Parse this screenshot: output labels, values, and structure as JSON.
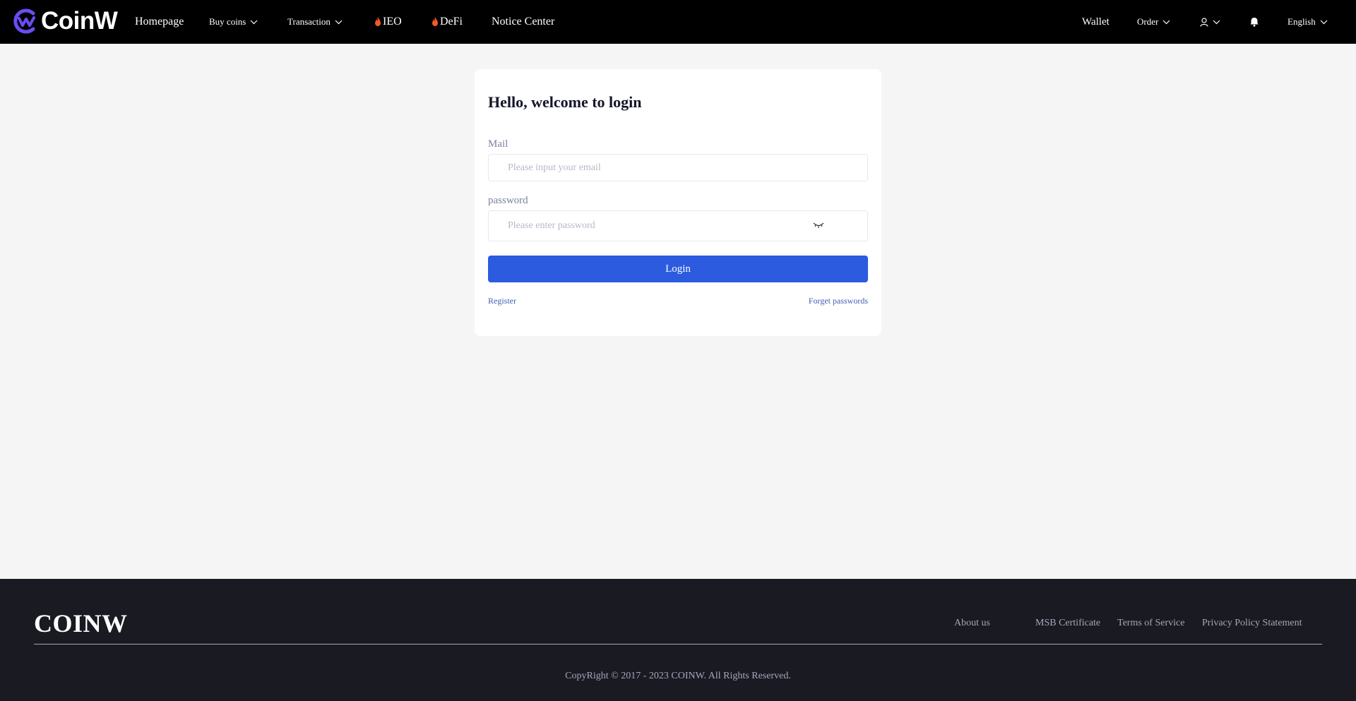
{
  "header": {
    "brand": "CoinW",
    "nav": {
      "homepage": "Homepage",
      "buy_coins": "Buy coins",
      "transaction": "Transaction",
      "ieo": "IEO",
      "defi": "DeFi",
      "notice_center": "Notice Center"
    },
    "right": {
      "wallet": "Wallet",
      "order": "Order",
      "language": "English"
    }
  },
  "login": {
    "title": "Hello, welcome to login",
    "mail_label": "Mail",
    "mail_placeholder": "Please input your email",
    "password_label": "password",
    "password_placeholder": "Please enter password",
    "login_button": "Login",
    "register_link": "Register",
    "forget_link": "Forget passwords"
  },
  "footer": {
    "brand": "COINW",
    "links": {
      "about": "About us",
      "msb": "MSB Certificate",
      "terms": "Terms of Service",
      "privacy": "Privacy Policy Statement"
    },
    "copyright": "CopyRight © 2017 - 2023 COINW. All Rights Reserved."
  },
  "colors": {
    "primary": "#2c5be0",
    "brand_purple": "#6c4cf5",
    "header_bg": "#000000",
    "page_bg": "#f5f5f5",
    "footer_bg": "#191a22",
    "flame": "#f05a28"
  },
  "icons": {
    "logo": "coinw-logo-icon",
    "dropdown": "chevron-down-icon",
    "hot": "flame-icon",
    "user": "user-icon",
    "notification": "bell-icon",
    "password_visibility": "eye-closed-icon"
  }
}
